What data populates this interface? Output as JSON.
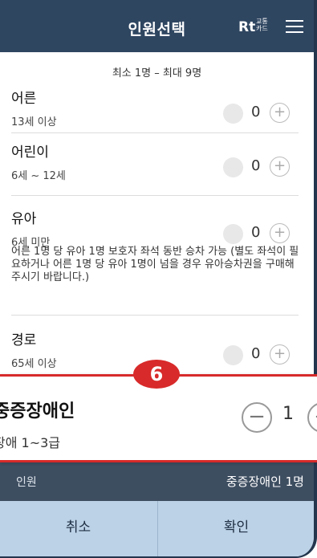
{
  "header": {
    "title": "인원선택",
    "card_logo": "Rt",
    "card_small": "교통 카드",
    "menu_icon": "hamburger-icon"
  },
  "limit_text": "최소 1명 – 최대 9명",
  "categories": [
    {
      "name": "어른",
      "desc": "13세 이상",
      "count": "0"
    },
    {
      "name": "어린이",
      "desc": "6세 ~ 12세",
      "count": "0"
    },
    {
      "name": "유아",
      "desc": "6세 미만",
      "count": "0"
    },
    {
      "name": "경로",
      "desc": "65세 이상",
      "count": "0"
    }
  ],
  "infant_note": "어른 1명 당 유아 1명 보호자 좌석 동반 승차 가능 (별도 좌석이 필요하거나 어른 1명 당 유아 1명이 넘을 경우 유아승차권을 구매해주시기 바랍니다.)",
  "zoomed": {
    "name": "중증장애인",
    "desc": "장애 1~3급",
    "count": "1"
  },
  "badge": "6",
  "summary": {
    "label": "인원",
    "value": "중증장애인 1명"
  },
  "buttons": {
    "cancel": "취소",
    "confirm": "확인"
  },
  "colors": {
    "header": "#2f4661",
    "summary": "#3e4e61",
    "footer": "#bcd2e6",
    "highlight": "#d82a2a"
  }
}
